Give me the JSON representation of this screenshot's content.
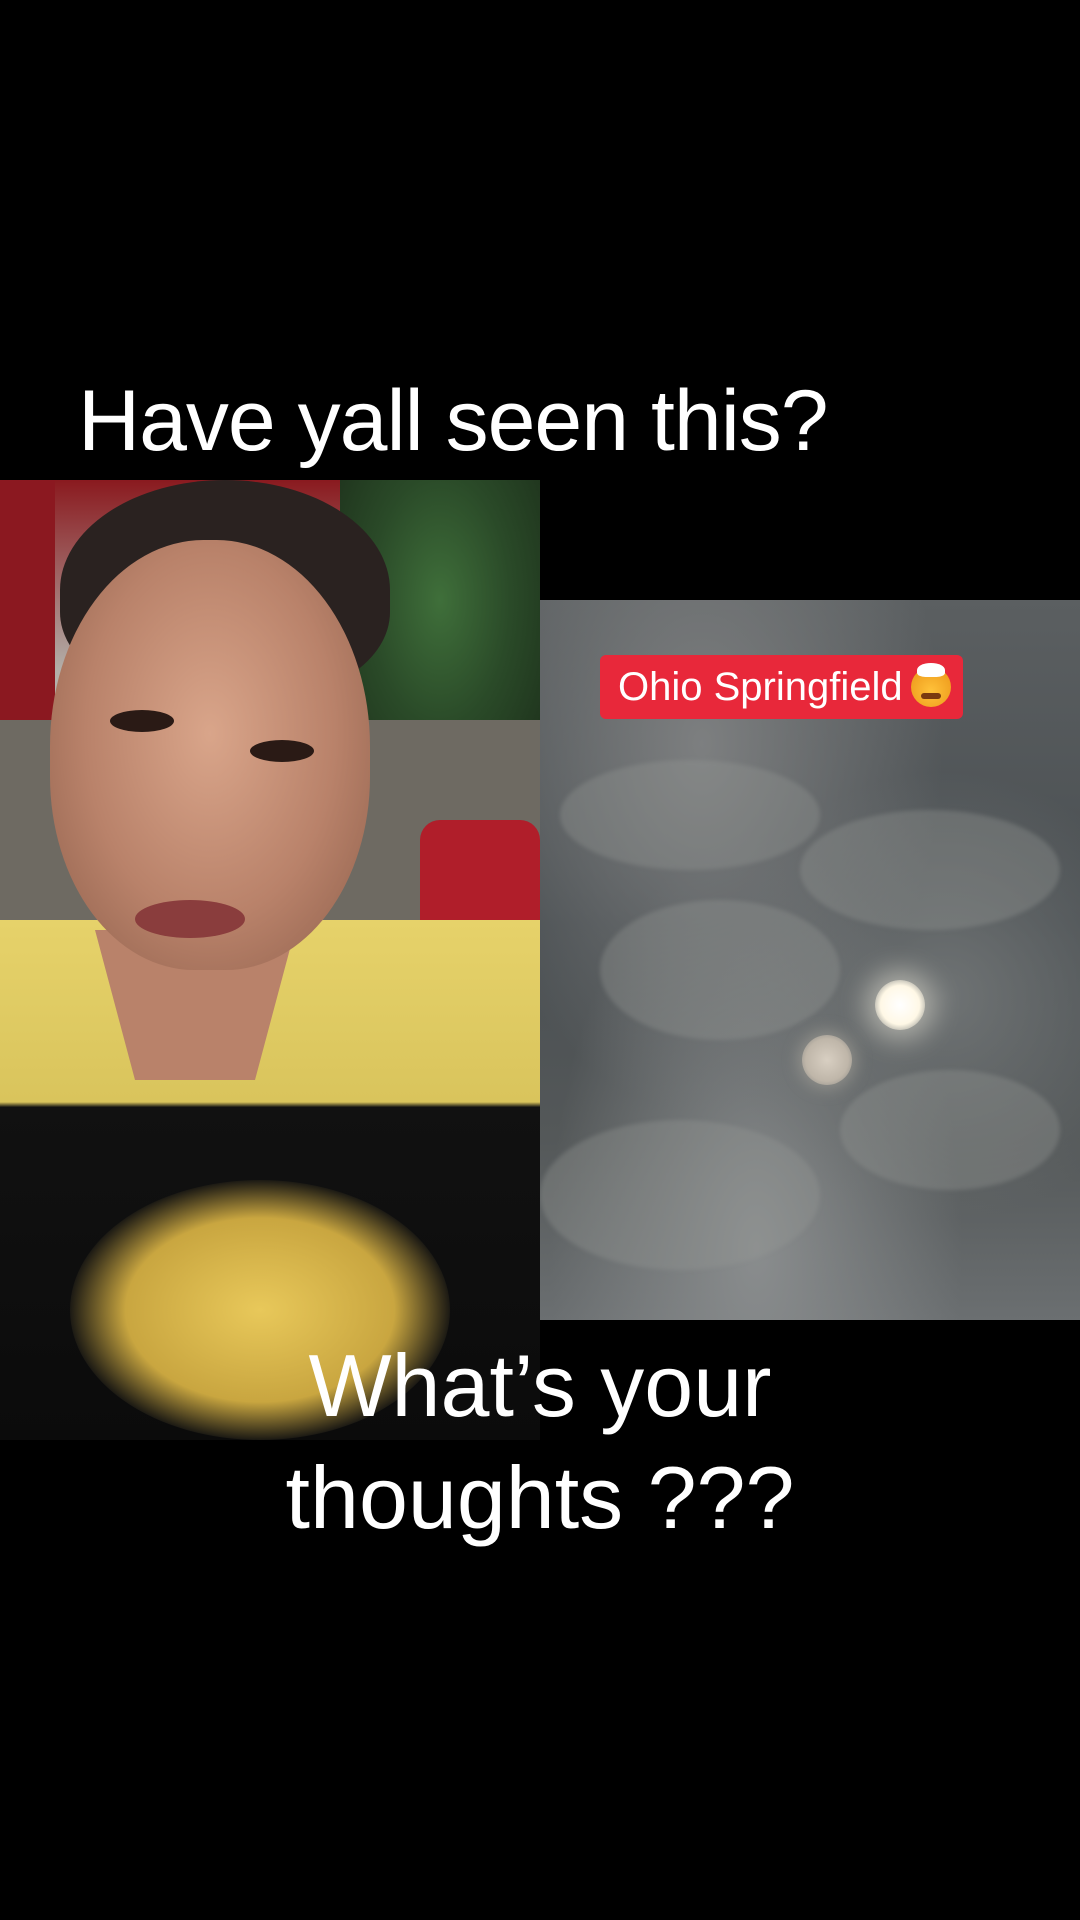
{
  "captions": {
    "top": "Have yall seen this?",
    "bottom_line1": "What’s your",
    "bottom_line2": "thoughts ???"
  },
  "sky_panel": {
    "tag_text": "Ohio Springfield",
    "tag_emoji": "exploding-head-emoji",
    "tag_color": "#e8283a"
  },
  "colors": {
    "background": "#000000",
    "caption_text": "#ffffff"
  }
}
